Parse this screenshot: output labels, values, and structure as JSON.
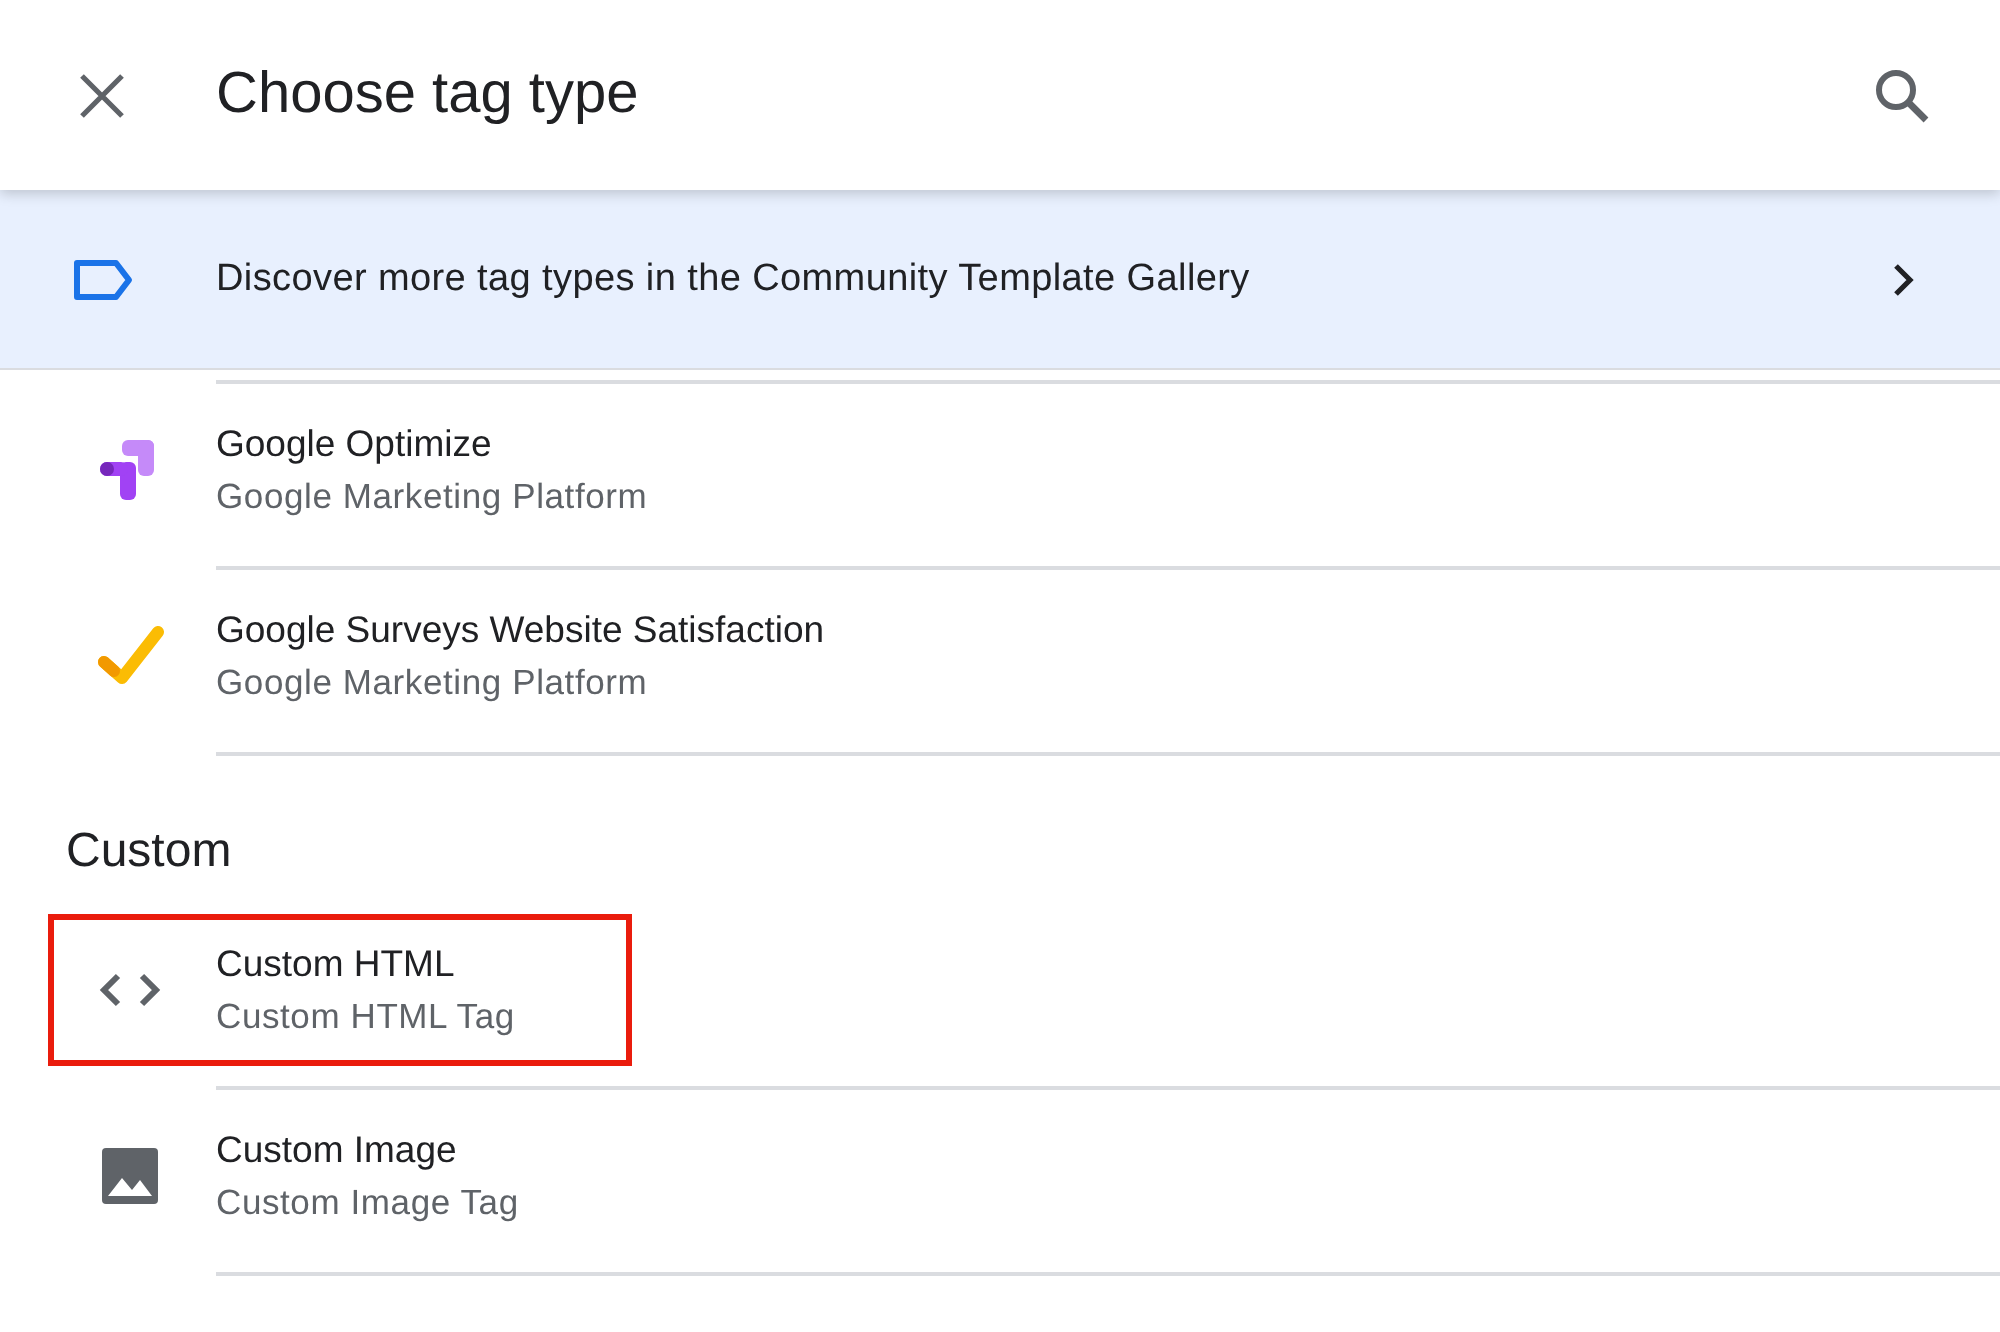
{
  "header": {
    "title": "Choose tag type"
  },
  "banner": {
    "text": "Discover more tag types in the Community Template Gallery"
  },
  "sections": [
    {
      "items": [
        {
          "kind": "optimize",
          "title": "Google Optimize",
          "subtitle": "Google Marketing Platform",
          "highlighted": false
        },
        {
          "kind": "surveys",
          "title": "Google Surveys Website Satisfaction",
          "subtitle": "Google Marketing Platform",
          "highlighted": false
        }
      ]
    },
    {
      "heading": "Custom",
      "items": [
        {
          "kind": "code",
          "title": "Custom HTML",
          "subtitle": "Custom HTML Tag",
          "highlighted": true
        },
        {
          "kind": "image",
          "title": "Custom Image",
          "subtitle": "Custom Image Tag",
          "highlighted": false
        }
      ]
    }
  ]
}
